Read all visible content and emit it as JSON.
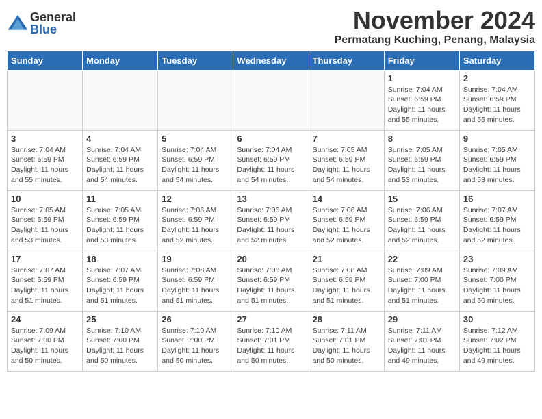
{
  "header": {
    "logo_general": "General",
    "logo_blue": "Blue",
    "month_title": "November 2024",
    "location": "Permatang Kuching, Penang, Malaysia"
  },
  "weekdays": [
    "Sunday",
    "Monday",
    "Tuesday",
    "Wednesday",
    "Thursday",
    "Friday",
    "Saturday"
  ],
  "weeks": [
    [
      {
        "day": "",
        "info": ""
      },
      {
        "day": "",
        "info": ""
      },
      {
        "day": "",
        "info": ""
      },
      {
        "day": "",
        "info": ""
      },
      {
        "day": "",
        "info": ""
      },
      {
        "day": "1",
        "info": "Sunrise: 7:04 AM\nSunset: 6:59 PM\nDaylight: 11 hours\nand 55 minutes."
      },
      {
        "day": "2",
        "info": "Sunrise: 7:04 AM\nSunset: 6:59 PM\nDaylight: 11 hours\nand 55 minutes."
      }
    ],
    [
      {
        "day": "3",
        "info": "Sunrise: 7:04 AM\nSunset: 6:59 PM\nDaylight: 11 hours\nand 55 minutes."
      },
      {
        "day": "4",
        "info": "Sunrise: 7:04 AM\nSunset: 6:59 PM\nDaylight: 11 hours\nand 54 minutes."
      },
      {
        "day": "5",
        "info": "Sunrise: 7:04 AM\nSunset: 6:59 PM\nDaylight: 11 hours\nand 54 minutes."
      },
      {
        "day": "6",
        "info": "Sunrise: 7:04 AM\nSunset: 6:59 PM\nDaylight: 11 hours\nand 54 minutes."
      },
      {
        "day": "7",
        "info": "Sunrise: 7:05 AM\nSunset: 6:59 PM\nDaylight: 11 hours\nand 54 minutes."
      },
      {
        "day": "8",
        "info": "Sunrise: 7:05 AM\nSunset: 6:59 PM\nDaylight: 11 hours\nand 53 minutes."
      },
      {
        "day": "9",
        "info": "Sunrise: 7:05 AM\nSunset: 6:59 PM\nDaylight: 11 hours\nand 53 minutes."
      }
    ],
    [
      {
        "day": "10",
        "info": "Sunrise: 7:05 AM\nSunset: 6:59 PM\nDaylight: 11 hours\nand 53 minutes."
      },
      {
        "day": "11",
        "info": "Sunrise: 7:05 AM\nSunset: 6:59 PM\nDaylight: 11 hours\nand 53 minutes."
      },
      {
        "day": "12",
        "info": "Sunrise: 7:06 AM\nSunset: 6:59 PM\nDaylight: 11 hours\nand 52 minutes."
      },
      {
        "day": "13",
        "info": "Sunrise: 7:06 AM\nSunset: 6:59 PM\nDaylight: 11 hours\nand 52 minutes."
      },
      {
        "day": "14",
        "info": "Sunrise: 7:06 AM\nSunset: 6:59 PM\nDaylight: 11 hours\nand 52 minutes."
      },
      {
        "day": "15",
        "info": "Sunrise: 7:06 AM\nSunset: 6:59 PM\nDaylight: 11 hours\nand 52 minutes."
      },
      {
        "day": "16",
        "info": "Sunrise: 7:07 AM\nSunset: 6:59 PM\nDaylight: 11 hours\nand 52 minutes."
      }
    ],
    [
      {
        "day": "17",
        "info": "Sunrise: 7:07 AM\nSunset: 6:59 PM\nDaylight: 11 hours\nand 51 minutes."
      },
      {
        "day": "18",
        "info": "Sunrise: 7:07 AM\nSunset: 6:59 PM\nDaylight: 11 hours\nand 51 minutes."
      },
      {
        "day": "19",
        "info": "Sunrise: 7:08 AM\nSunset: 6:59 PM\nDaylight: 11 hours\nand 51 minutes."
      },
      {
        "day": "20",
        "info": "Sunrise: 7:08 AM\nSunset: 6:59 PM\nDaylight: 11 hours\nand 51 minutes."
      },
      {
        "day": "21",
        "info": "Sunrise: 7:08 AM\nSunset: 6:59 PM\nDaylight: 11 hours\nand 51 minutes."
      },
      {
        "day": "22",
        "info": "Sunrise: 7:09 AM\nSunset: 7:00 PM\nDaylight: 11 hours\nand 51 minutes."
      },
      {
        "day": "23",
        "info": "Sunrise: 7:09 AM\nSunset: 7:00 PM\nDaylight: 11 hours\nand 50 minutes."
      }
    ],
    [
      {
        "day": "24",
        "info": "Sunrise: 7:09 AM\nSunset: 7:00 PM\nDaylight: 11 hours\nand 50 minutes."
      },
      {
        "day": "25",
        "info": "Sunrise: 7:10 AM\nSunset: 7:00 PM\nDaylight: 11 hours\nand 50 minutes."
      },
      {
        "day": "26",
        "info": "Sunrise: 7:10 AM\nSunset: 7:00 PM\nDaylight: 11 hours\nand 50 minutes."
      },
      {
        "day": "27",
        "info": "Sunrise: 7:10 AM\nSunset: 7:01 PM\nDaylight: 11 hours\nand 50 minutes."
      },
      {
        "day": "28",
        "info": "Sunrise: 7:11 AM\nSunset: 7:01 PM\nDaylight: 11 hours\nand 50 minutes."
      },
      {
        "day": "29",
        "info": "Sunrise: 7:11 AM\nSunset: 7:01 PM\nDaylight: 11 hours\nand 49 minutes."
      },
      {
        "day": "30",
        "info": "Sunrise: 7:12 AM\nSunset: 7:02 PM\nDaylight: 11 hours\nand 49 minutes."
      }
    ]
  ]
}
